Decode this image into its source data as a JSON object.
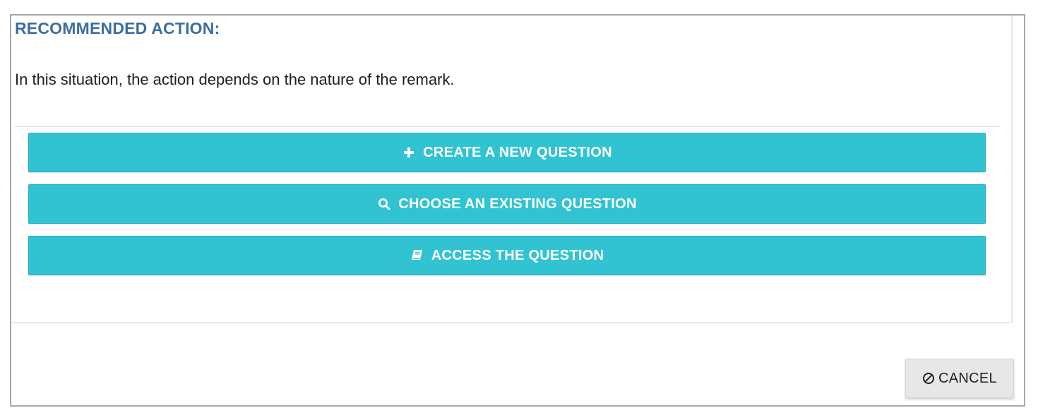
{
  "recommendation": {
    "heading": "RECOMMENDED ACTION:",
    "description": "In this situation, the action depends on the nature of the remark."
  },
  "actions": [
    {
      "label": "CREATE A NEW QUESTION",
      "icon": "plus-icon"
    },
    {
      "label": "CHOOSE AN EXISTING QUESTION",
      "icon": "search-icon"
    },
    {
      "label": "ACCESS THE QUESTION",
      "icon": "book-icon"
    }
  ],
  "footer": {
    "cancel_label": "CANCEL",
    "cancel_icon": "ban-icon"
  },
  "colors": {
    "heading": "#3c6e9e",
    "action_button": "#31c3d2",
    "cancel_button": "#e7e7e7"
  }
}
